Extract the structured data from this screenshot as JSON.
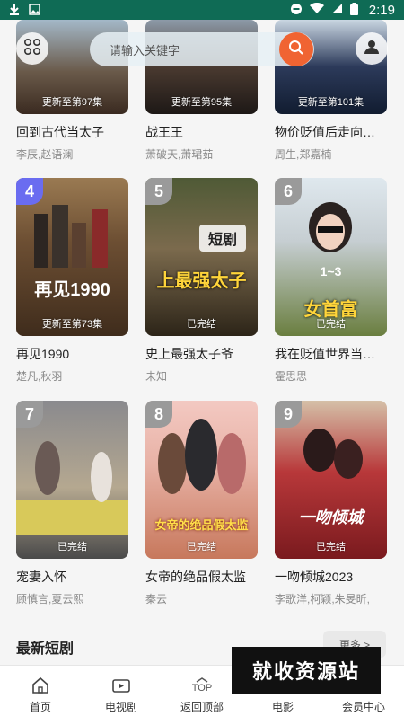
{
  "status_bar": {
    "time": "2:19",
    "icons": [
      "download-icon",
      "image-icon",
      "minus-circle-icon",
      "wifi-icon",
      "signal-icon",
      "battery-icon"
    ],
    "bg_color": "#0f6b55"
  },
  "header": {
    "search_placeholder": "请输入关键字",
    "accent_color": "#f06432"
  },
  "rows": [
    {
      "items": [
        {
          "title": "回到古代当太子",
          "cast": "李辰,赵语澜",
          "episode": "更新至第97集"
        },
        {
          "title": "战王王",
          "cast": "萧破天,萧珺茹",
          "episode": "更新至第95集"
        },
        {
          "title": "物价贬值后走向巅峰",
          "cast": "周生,郑嘉楠",
          "episode": "更新至第101集"
        }
      ]
    },
    {
      "items": [
        {
          "rank": "4",
          "title": "再见1990",
          "cast": "楚凡,秋羽",
          "episode": "更新至第73集",
          "poster_text": "再见1990",
          "rank_color": "#6a6cf0"
        },
        {
          "rank": "5",
          "title": "史上最强太子爷",
          "cast": "未知",
          "episode": "已完结",
          "poster_text": "上最强太子",
          "poster_tag": "短剧",
          "rank_color": "#9a9a9a"
        },
        {
          "rank": "6",
          "title": "我在贬值世界当女首富",
          "cast": "霍思思",
          "episode": "已完结",
          "poster_text": "女首富",
          "poster_sub": "1~3",
          "rank_color": "#9a9a9a"
        }
      ]
    },
    {
      "items": [
        {
          "rank": "7",
          "title": "宠妻入怀",
          "cast": "顾慎言,夏云熙",
          "episode": "已完结",
          "rank_color": "#9a9a9a"
        },
        {
          "rank": "8",
          "title": "女帝的绝品假太监",
          "cast": "秦云",
          "episode": "已完结",
          "poster_text": "女帝的绝品假太监",
          "rank_color": "#9a9a9a"
        },
        {
          "rank": "9",
          "title": "一吻倾城2023",
          "cast": "李歌洋,柯颖,朱旻昕,",
          "episode": "已完结",
          "poster_text": "一吻倾城",
          "rank_color": "#9a9a9a"
        }
      ]
    }
  ],
  "section": {
    "title": "最新短剧",
    "more_label": "更多 >"
  },
  "watermark": "就收资源站",
  "bottom_nav": [
    {
      "label": "首页",
      "icon": "home-icon"
    },
    {
      "label": "电视剧",
      "icon": "tv-icon"
    },
    {
      "label": "返回顶部",
      "icon": "top-arrow-icon",
      "top_text": "TOP"
    },
    {
      "label": "电影",
      "icon": "film-icon"
    },
    {
      "label": "会员中心",
      "icon": "user-icon"
    }
  ]
}
